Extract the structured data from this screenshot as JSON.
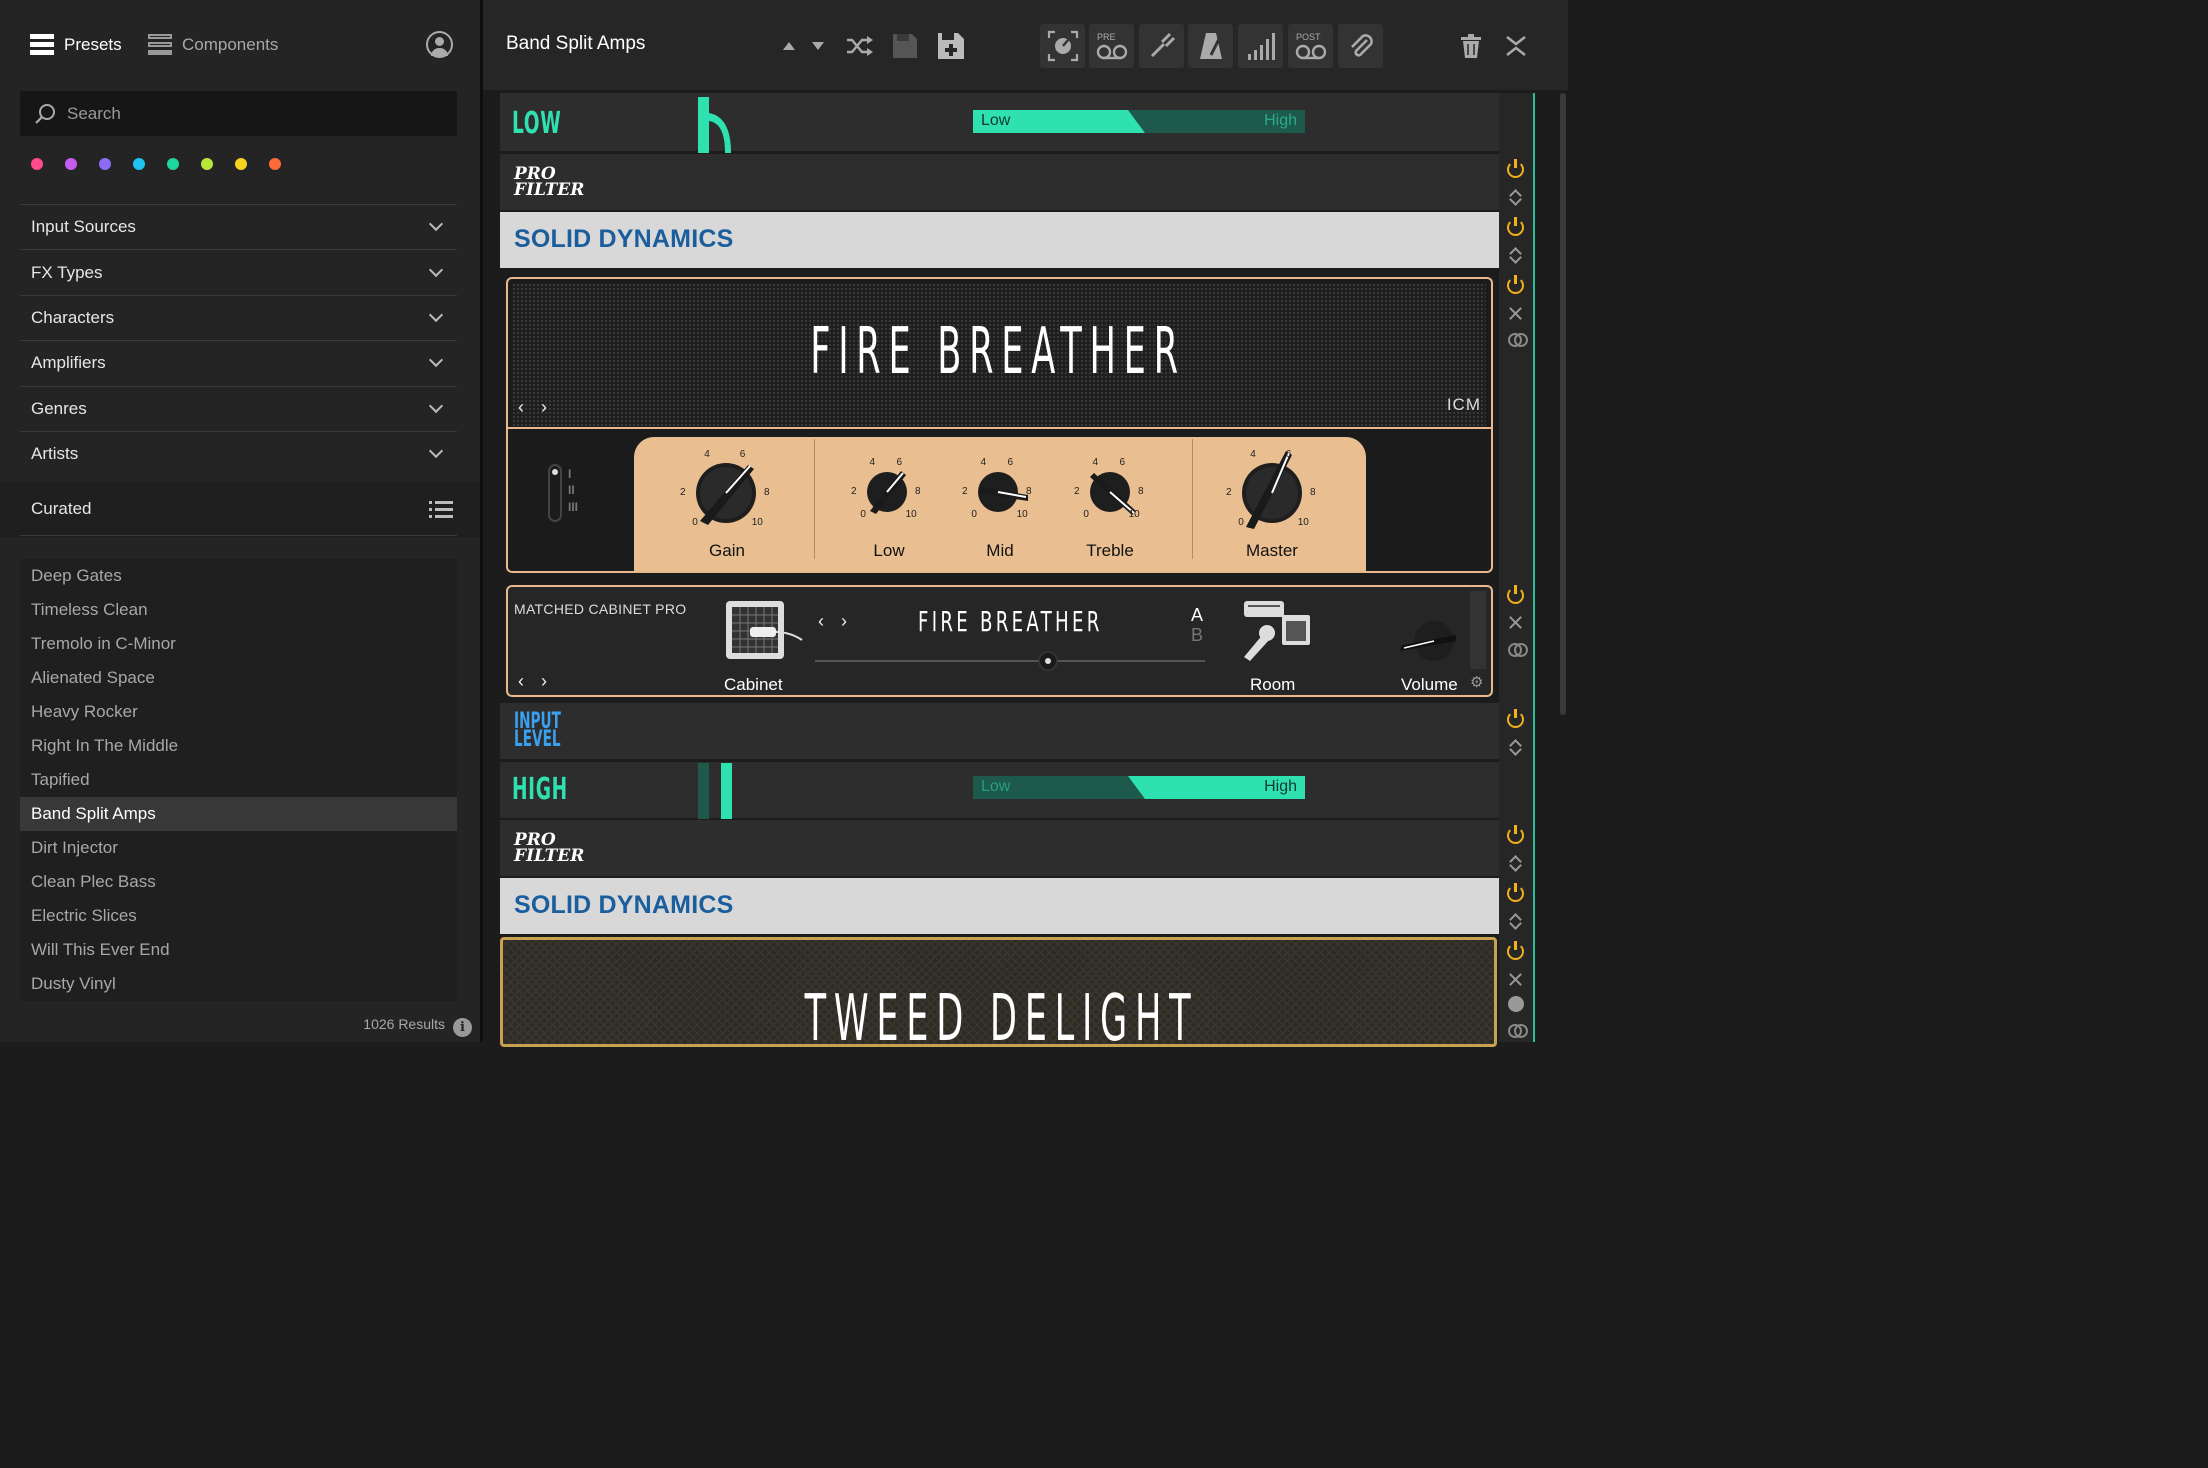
{
  "sidebar": {
    "tabs": {
      "presets": "Presets",
      "components": "Components"
    },
    "search": {
      "placeholder": "Search"
    },
    "color_tags": [
      "#ff4b8b",
      "#c45cf0",
      "#8a6cf5",
      "#1fc3ef",
      "#1fd6a0",
      "#b6e63a",
      "#f5d320",
      "#ff6a3a"
    ],
    "filters": [
      "Input Sources",
      "FX Types",
      "Characters",
      "Amplifiers",
      "Genres",
      "Artists"
    ],
    "curated_label": "Curated",
    "presets": [
      "Deep Gates",
      "Timeless Clean",
      "Tremolo in C-Minor",
      "Alienated Space",
      "Heavy Rocker",
      "Right In The Middle",
      "Tapified",
      "Band Split Amps",
      "Dirt Injector",
      "Clean Plec Bass",
      "Electric Slices",
      "Will This Ever End",
      "Dusty Vinyl"
    ],
    "active_preset": "Band Split Amps",
    "results": "1026 Results"
  },
  "toolbar": {
    "preset_name": "Band Split Amps",
    "pre_label": "PRE",
    "post_label": "POST"
  },
  "rack": {
    "low_band": {
      "title": "LOW",
      "low_label": "Low",
      "high_label": "High"
    },
    "pro_filter_1": "PRO\nFILTER",
    "solid_dynamics_1": "SOLID DYNAMICS",
    "amp": {
      "name": "FIRE BREATHER",
      "brand": "ICM",
      "knobs": [
        "Gain",
        "Low",
        "Mid",
        "Treble",
        "Master"
      ],
      "channel_marks": [
        "I",
        "II",
        "III"
      ]
    },
    "cabinet": {
      "title": "MATCHED CABINET PRO",
      "name": "FIRE BREATHER",
      "a": "A",
      "b": "B",
      "cabinet_label": "Cabinet",
      "room_label": "Room",
      "volume_label": "Volume"
    },
    "input_level": "INPUT\nLEVEL",
    "high_band": {
      "title": "HIGH",
      "low_label": "Low",
      "high_label": "High"
    },
    "pro_filter_2": "PRO\nFILTER",
    "solid_dynamics_2": "SOLID DYNAMICS",
    "amp2": {
      "name": "TWEED DELIGHT"
    },
    "scale_labels": [
      "0",
      "2",
      "4",
      "6",
      "8",
      "10"
    ]
  }
}
